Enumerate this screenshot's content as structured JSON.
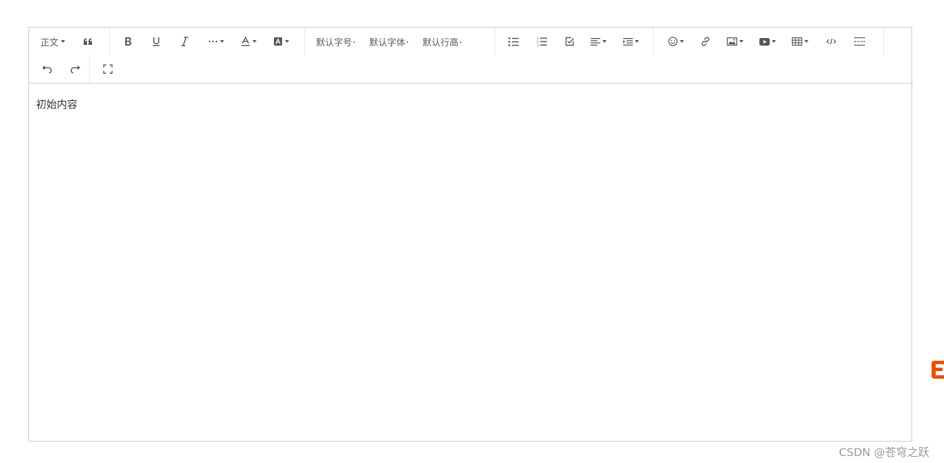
{
  "toolbar": {
    "heading_label": "正文",
    "font_size_label": "默认字号",
    "font_family_label": "默认字体",
    "line_height_label": "默认行高",
    "items": [
      {
        "name": "blockquote",
        "icon": "quote-icon"
      },
      {
        "name": "bold",
        "icon": "bold-icon"
      },
      {
        "name": "underline",
        "icon": "underline-icon"
      },
      {
        "name": "italic",
        "icon": "italic-icon"
      },
      {
        "name": "more-style",
        "icon": "more-icon"
      },
      {
        "name": "font-color",
        "icon": "font-color-icon"
      },
      {
        "name": "bg-color",
        "icon": "bg-color-icon"
      },
      {
        "name": "bulleted-list",
        "icon": "bulleted-list-icon"
      },
      {
        "name": "numbered-list",
        "icon": "numbered-list-icon"
      },
      {
        "name": "todo",
        "icon": "checkbox-icon"
      },
      {
        "name": "justify",
        "icon": "align-left-icon"
      },
      {
        "name": "indent",
        "icon": "indent-icon"
      },
      {
        "name": "emotion",
        "icon": "smiley-icon"
      },
      {
        "name": "link",
        "icon": "link-icon"
      },
      {
        "name": "image",
        "icon": "image-icon"
      },
      {
        "name": "video",
        "icon": "video-icon"
      },
      {
        "name": "table",
        "icon": "table-icon"
      },
      {
        "name": "code-block",
        "icon": "code-icon"
      },
      {
        "name": "divider",
        "icon": "divider-icon"
      },
      {
        "name": "undo",
        "icon": "undo-icon"
      },
      {
        "name": "redo",
        "icon": "redo-icon"
      },
      {
        "name": "fullscreen",
        "icon": "fullscreen-icon"
      }
    ]
  },
  "content": {
    "text": "初始内容"
  },
  "watermark": {
    "text": "CSDN @苍穹之跃"
  },
  "colors": {
    "border": "#cccccc",
    "icon": "#595959",
    "logo": "#e8500a"
  }
}
